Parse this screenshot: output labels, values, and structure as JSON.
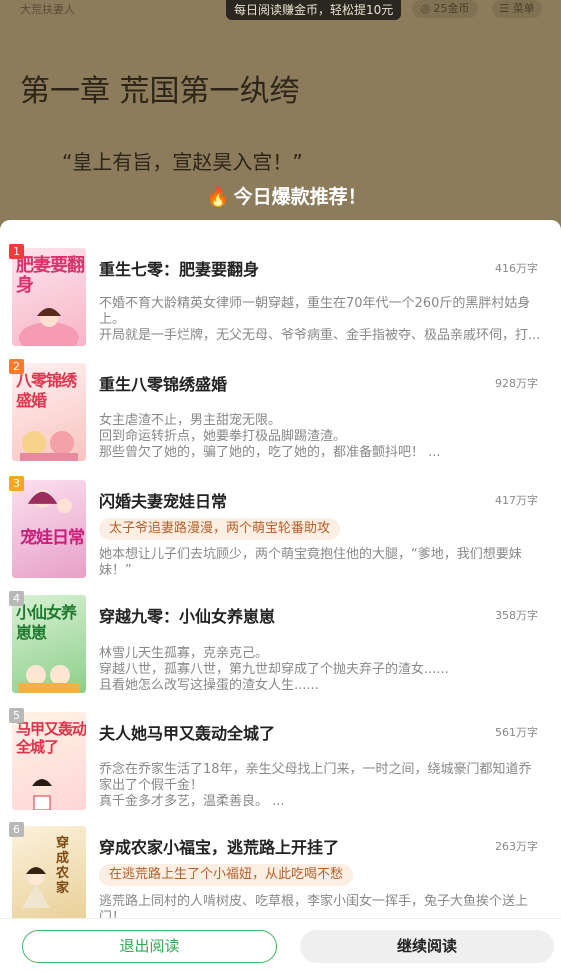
{
  "reader": {
    "book_title": "大荒扶妻人",
    "promo": "每日阅读赚金币，轻松提10元",
    "coins": "25金币",
    "menu": "菜单",
    "chapter_title": "第一章 荒国第一纨绔",
    "first_line": "“皇上有旨，宣赵昊入宫！”",
    "hot_title": "今日爆款推荐！"
  },
  "books": [
    {
      "rank": "1",
      "title": "重生七零：肥妻要翻身",
      "words": "416万字",
      "cover_text": "肥妻要翻身",
      "desc": [
        "不婚不育大龄精英女律师一朝穿越，重生在70年代一个260斤的黑胖村姑身上。",
        "开局就是一手烂牌，无父无母、爷爷病重、金手指被夺、极品亲戚环伺，打..."
      ]
    },
    {
      "rank": "2",
      "title": "重生八零锦绣盛婚",
      "words": "928万字",
      "cover_text": "八零锦绣盛婚",
      "desc": [
        "女主虐渣不止，男主甜宠无限。",
        "回到命运转折点，她要拳打极品脚踢渣渣。",
        "那些曾欠了她的，骗了她的，吃了她的，都准备颤抖吧！ ..."
      ]
    },
    {
      "rank": "3",
      "title": "闪婚夫妻宠娃日常",
      "words": "417万字",
      "cover_text": "宠娃日常",
      "tag": "太子爷追妻路漫漫，两个萌宝轮番助攻",
      "desc": [
        "她本想让儿子们去坑顾少，两个萌宝竟抱住他的大腿，“爹地，我们想要妹妹！”"
      ]
    },
    {
      "rank": "4",
      "title": "穿越九零：小仙女养崽崽",
      "words": "358万字",
      "cover_text": "小仙女养崽崽",
      "desc": [
        "林雪儿天生孤寡，克亲克己。",
        "穿越八世，孤寡八世，第九世却穿成了个抛夫弃子的渣女......",
        "且看她怎么改写这操蛋的渣女人生......"
      ]
    },
    {
      "rank": "5",
      "title": "夫人她马甲又轰动全城了",
      "words": "561万字",
      "cover_text": "马甲又轰动全城了",
      "desc": [
        "乔念在乔家生活了18年，亲生父母找上门来，一时之间，绕城豪门都知道乔家出了个假千金！",
        "真千金多才多艺，温柔善良。 ..."
      ]
    },
    {
      "rank": "6",
      "title": "穿成农家小福宝，逃荒路上开挂了",
      "words": "263万字",
      "cover_text": "穿成农家",
      "tag": "在逃荒路上生了个小福妞，从此吃喝不愁",
      "desc": [
        "逃荒路上同村的人啃树皮、吃草根，李家小闺女一挥手，兔子大鱼挨个送上门！"
      ]
    }
  ],
  "footer": {
    "exit_label": "退出阅读",
    "continue_label": "继续阅读"
  },
  "colors": {
    "accent_green": "#3cb85c",
    "rank_red": "#f23a3a",
    "rank_orange": "#ff7a2a",
    "rank_gold": "#f5a623",
    "rank_gray": "#b8b8b8",
    "tag_bg": "#fbeee2",
    "tag_text": "#b4602b"
  }
}
